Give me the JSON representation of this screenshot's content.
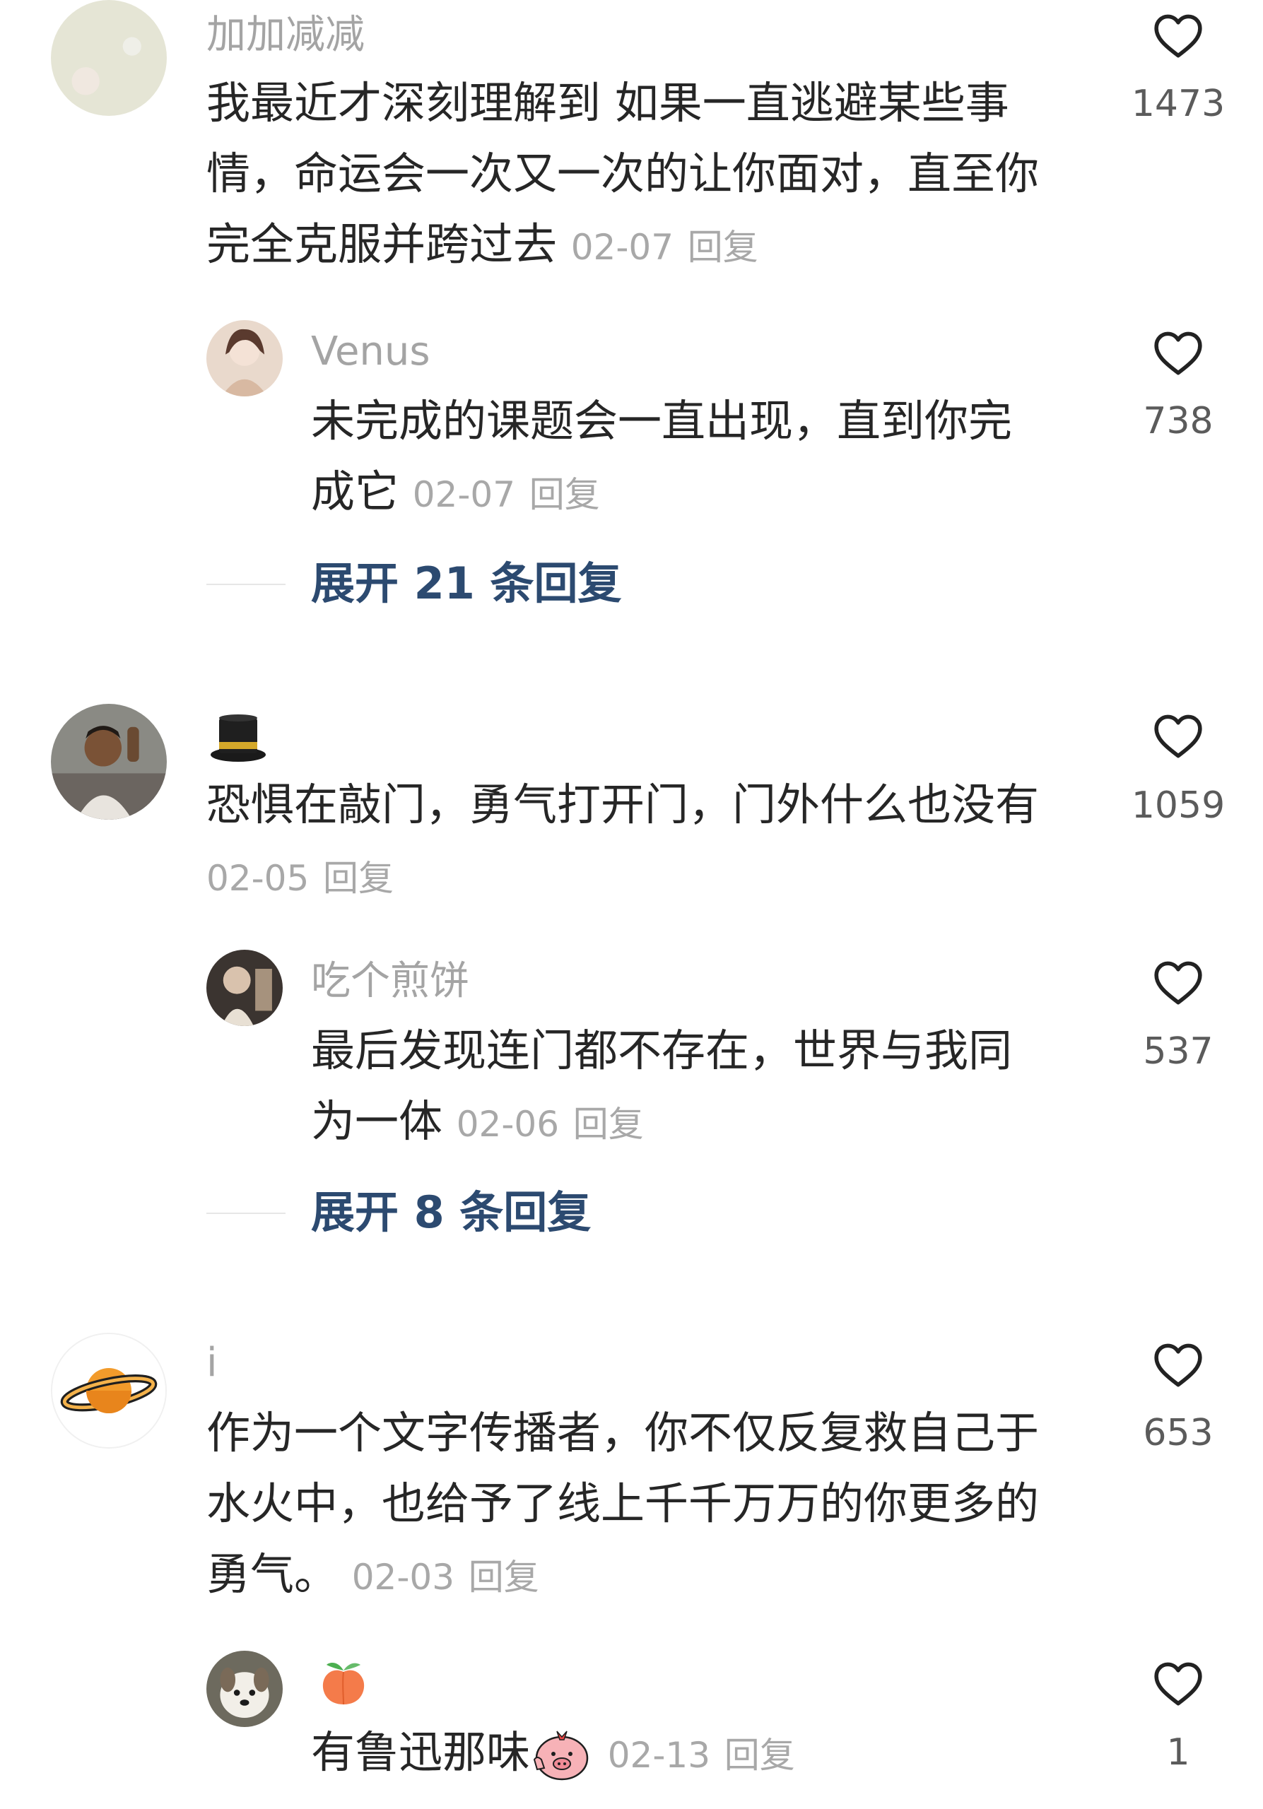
{
  "comments": [
    {
      "username": "加加减减",
      "lines": [
        "我最近才深刻理解到 如果一直逃避某些事",
        "情，命运会一次又一次的让你面对，直至你"
      ],
      "last_line": "完全克服并跨过去",
      "date": "02-07",
      "reply_label": "回复",
      "likes": "1473",
      "icon": "heart-outline-icon"
    },
    {
      "username": "Venus",
      "lines": [
        "未完成的课题会一直出现，直到你完"
      ],
      "last_line": "成它",
      "date": "02-07",
      "reply_label": "回复",
      "likes": "738",
      "icon": "heart-outline-icon"
    },
    {
      "username_emoji": "top-hat-icon",
      "lines": [
        "恐惧在敲门，勇气打开门，门外什么也没有"
      ],
      "last_line": "",
      "date": "02-05",
      "reply_label": "回复",
      "likes": "1059",
      "icon": "heart-outline-icon"
    },
    {
      "username": "吃个煎饼",
      "lines": [
        "最后发现连门都不存在，世界与我同"
      ],
      "last_line": "为一体",
      "date": "02-06",
      "reply_label": "回复",
      "likes": "537",
      "icon": "heart-outline-icon"
    },
    {
      "username": "i",
      "lines": [
        "作为一个文字传播者，你不仅反复救自己于",
        "水火中，也给予了线上千千万万的你更多的"
      ],
      "last_line": "勇气。",
      "date": "02-03",
      "reply_label": "回复",
      "likes": "653",
      "icon": "heart-outline-icon"
    },
    {
      "username_emoji": "peach-icon",
      "last_line": "有鲁迅那味",
      "inline_emoji": "pig-thumbs-up-icon",
      "date": "02-13",
      "reply_label": "回复",
      "likes": "1",
      "icon": "heart-outline-icon"
    }
  ],
  "expand_replies": [
    {
      "label": "展开 21 条回复"
    },
    {
      "label": "展开 8 条回复"
    }
  ],
  "colors": {
    "username": "#a4a4a4",
    "text": "#262626",
    "meta": "#a8a8a8",
    "expand_link": "#2c4a70",
    "likes": "#5b5b5b"
  }
}
